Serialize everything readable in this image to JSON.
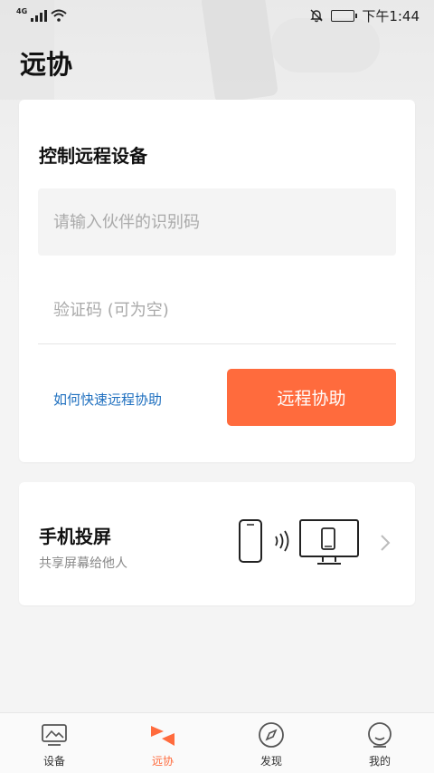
{
  "status_bar": {
    "network": "4G",
    "time": "下午1:44"
  },
  "header": {
    "title": "远协"
  },
  "remote_card": {
    "title": "控制远程设备",
    "partner_id_placeholder": "请输入伙伴的识别码",
    "partner_id_value": "",
    "verify_code_placeholder": "验证码 (可为空)",
    "verify_code_value": "",
    "help_link": "如何快速远程协助",
    "assist_button": "远程协助"
  },
  "cast_card": {
    "title": "手机投屏",
    "subtitle": "共享屏幕给他人"
  },
  "tab_bar": {
    "tabs": [
      {
        "label": "设备",
        "icon": "device-icon",
        "active": false
      },
      {
        "label": "远协",
        "icon": "remote-assist-icon",
        "active": true
      },
      {
        "label": "发现",
        "icon": "compass-icon",
        "active": false
      },
      {
        "label": "我的",
        "icon": "profile-icon",
        "active": false
      }
    ]
  },
  "colors": {
    "accent": "#ff6b3d",
    "link": "#1e6fbf",
    "background": "#f4f4f4"
  }
}
